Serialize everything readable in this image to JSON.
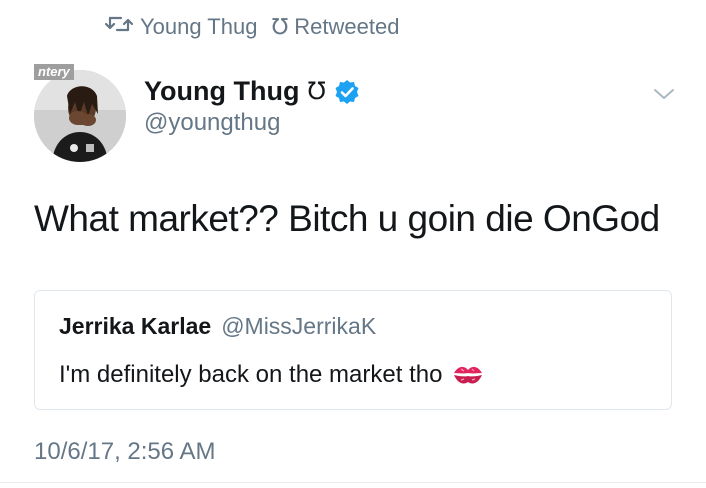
{
  "retweet_bar": {
    "icon": "retweet-icon",
    "user": "Young Thug",
    "user_emoji": "℧",
    "action": "Retweeted"
  },
  "avatar": {
    "watermark": "ntery"
  },
  "author": {
    "display_name": "Young Thug",
    "name_emoji": "℧",
    "handle": "@youngthug",
    "verified_icon": "verified-badge-icon",
    "menu_icon": "chevron-down-icon"
  },
  "tweet": {
    "text": "What market?? Bitch u goin die OnGod",
    "timestamp": "10/6/17, 2:56 AM"
  },
  "quoted_tweet": {
    "display_name": "Jerrika Karlae",
    "handle": "@MissJerrikaK",
    "text": "I'm definitely back on the market tho",
    "emoji_icon": "kiss-mark-icon"
  },
  "colors": {
    "verified_blue": "#1da1f2",
    "secondary_text": "#657786",
    "primary_text": "#14171a",
    "card_border": "#e1e8ed",
    "kiss_red": "#e0245e"
  }
}
